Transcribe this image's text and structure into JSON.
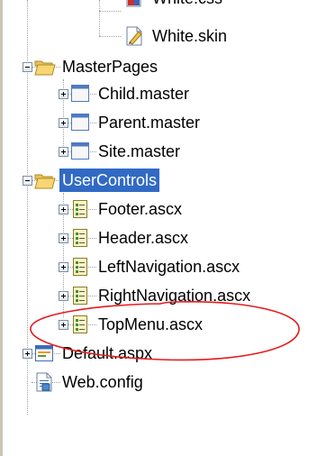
{
  "tree": {
    "top_partial_label": "White.css",
    "white_skin": "White.skin",
    "master_pages": {
      "label": "MasterPages",
      "children": [
        "Child.master",
        "Parent.master",
        "Site.master"
      ]
    },
    "user_controls": {
      "label": "UserControls",
      "children": [
        "Footer.ascx",
        "Header.ascx",
        "LeftNavigation.ascx",
        "RightNavigation.ascx",
        "TopMenu.ascx"
      ]
    },
    "default_aspx": "Default.aspx",
    "web_config": "Web.config"
  },
  "annotation": {
    "highlight_color": "#e8191b"
  }
}
